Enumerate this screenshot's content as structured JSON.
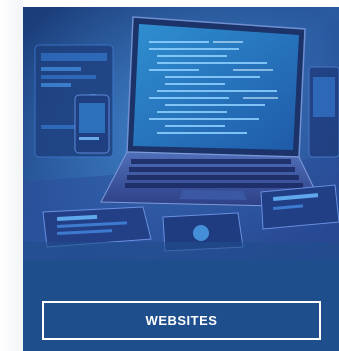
{
  "card": {
    "background_color": "#1f4e8c",
    "image_icon": "laptop-and-devices-illustration",
    "button_label": "WEBSITES"
  }
}
